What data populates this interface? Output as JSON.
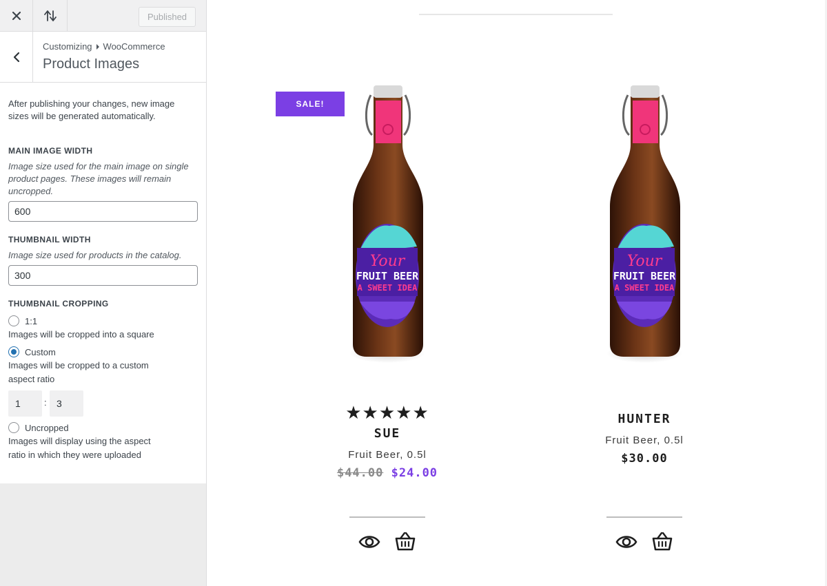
{
  "topbar": {
    "close_icon": "close-icon",
    "toggle_icon": "sort-arrows-icon",
    "publish_label": "Published"
  },
  "panel": {
    "back_icon": "chevron-left-icon",
    "breadcrumb_root": "Customizing",
    "breadcrumb_section": "WooCommerce",
    "title": "Product Images"
  },
  "controls": {
    "intro": "After publishing your changes, new image sizes will be generated automatically.",
    "main_width": {
      "label": "MAIN IMAGE WIDTH",
      "help": "Image size used for the main image on single product pages. These images will remain uncropped.",
      "value": "600"
    },
    "thumb_width": {
      "label": "THUMBNAIL WIDTH",
      "help": "Image size used for products in the catalog.",
      "value": "300"
    },
    "cropping": {
      "label": "THUMBNAIL CROPPING",
      "options": [
        {
          "label": "1:1",
          "desc": "Images will be cropped into a square",
          "selected": false
        },
        {
          "label": "Custom",
          "desc": "Images will be cropped to a custom aspect ratio",
          "selected": true
        },
        {
          "label": "Uncropped",
          "desc": "Images will display using the aspect ratio in which they were uploaded",
          "selected": false
        }
      ],
      "ratio_width": "1",
      "ratio_sep": ":",
      "ratio_height": "3"
    }
  },
  "products": [
    {
      "badge": "SALE!",
      "rating_stars": "★★★★★",
      "title": "SUE",
      "subtitle": "Fruit Beer, 0.5l",
      "old_price": "$44.00",
      "price": "$24.00",
      "label_line1": "Your",
      "label_line2": "FRUIT BEER",
      "label_line3": "A SWEET IDEA",
      "quick_view_icon": "eye-icon",
      "cart_icon": "basket-icon"
    },
    {
      "title": "HUNTER",
      "subtitle": "Fruit Beer, 0.5l",
      "price": "$30.00",
      "label_line1": "Your",
      "label_line2": "FRUIT BEER",
      "label_line3": "A SWEET IDEA",
      "quick_view_icon": "eye-icon",
      "cart_icon": "basket-icon"
    }
  ],
  "colors": {
    "accent": "#7b3fe4",
    "wp_blue": "#2271b1",
    "bottle_glass": "#5a2a12",
    "bottle_neck_label": "#f0357a"
  }
}
